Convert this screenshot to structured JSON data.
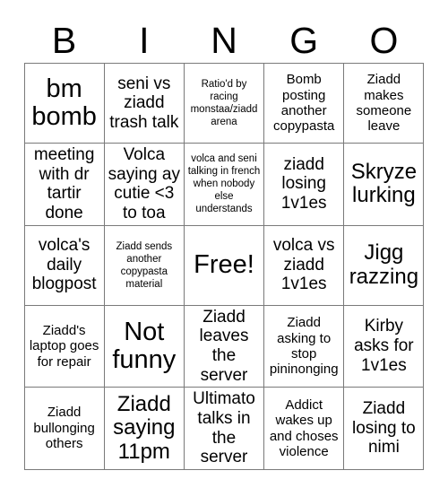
{
  "header": {
    "letters": [
      "B",
      "I",
      "N",
      "G",
      "O"
    ]
  },
  "grid": {
    "rows": 5,
    "columns": 5,
    "free_space_label": "Free!",
    "cells": [
      [
        {
          "text": "bm bomb",
          "size": "xl"
        },
        {
          "text": "seni vs ziadd trash talk",
          "size": "md"
        },
        {
          "text": "Ratio'd by racing monstaa/ziadd arena",
          "size": "xs"
        },
        {
          "text": "Bomb posting another copypasta",
          "size": "sm"
        },
        {
          "text": "Ziadd makes someone leave",
          "size": "sm"
        }
      ],
      [
        {
          "text": "meeting with dr tartir done",
          "size": "md"
        },
        {
          "text": "Volca saying ay cutie <3 to toa",
          "size": "md"
        },
        {
          "text": "volca and seni talking in french when nobody else understands",
          "size": "xs"
        },
        {
          "text": "ziadd losing 1v1es",
          "size": "md"
        },
        {
          "text": "Skryze lurking",
          "size": "lg"
        }
      ],
      [
        {
          "text": "volca's daily blogpost",
          "size": "md"
        },
        {
          "text": "Ziadd sends another copypasta material",
          "size": "xs"
        },
        {
          "text": "Free!",
          "size": "xl"
        },
        {
          "text": "volca vs ziadd 1v1es",
          "size": "md"
        },
        {
          "text": "Jigg razzing",
          "size": "lg"
        }
      ],
      [
        {
          "text": "Ziadd's laptop goes for repair",
          "size": "sm"
        },
        {
          "text": "Not funny",
          "size": "xl"
        },
        {
          "text": "Ziadd leaves the server",
          "size": "md"
        },
        {
          "text": "Ziadd asking to stop pininonging",
          "size": "sm"
        },
        {
          "text": "Kirby asks for 1v1es",
          "size": "md"
        }
      ],
      [
        {
          "text": "Ziadd bullonging others",
          "size": "sm"
        },
        {
          "text": "Ziadd saying 11pm",
          "size": "lg"
        },
        {
          "text": "Ultimato talks in the server",
          "size": "md"
        },
        {
          "text": "Addict wakes up and choses violence",
          "size": "sm"
        },
        {
          "text": "Ziadd losing to nimi",
          "size": "md"
        }
      ]
    ]
  },
  "colors": {
    "background": "#ffffff",
    "text": "#000000",
    "grid_line": "#7a7a7a",
    "grid_outer": "#6b6b6b"
  }
}
